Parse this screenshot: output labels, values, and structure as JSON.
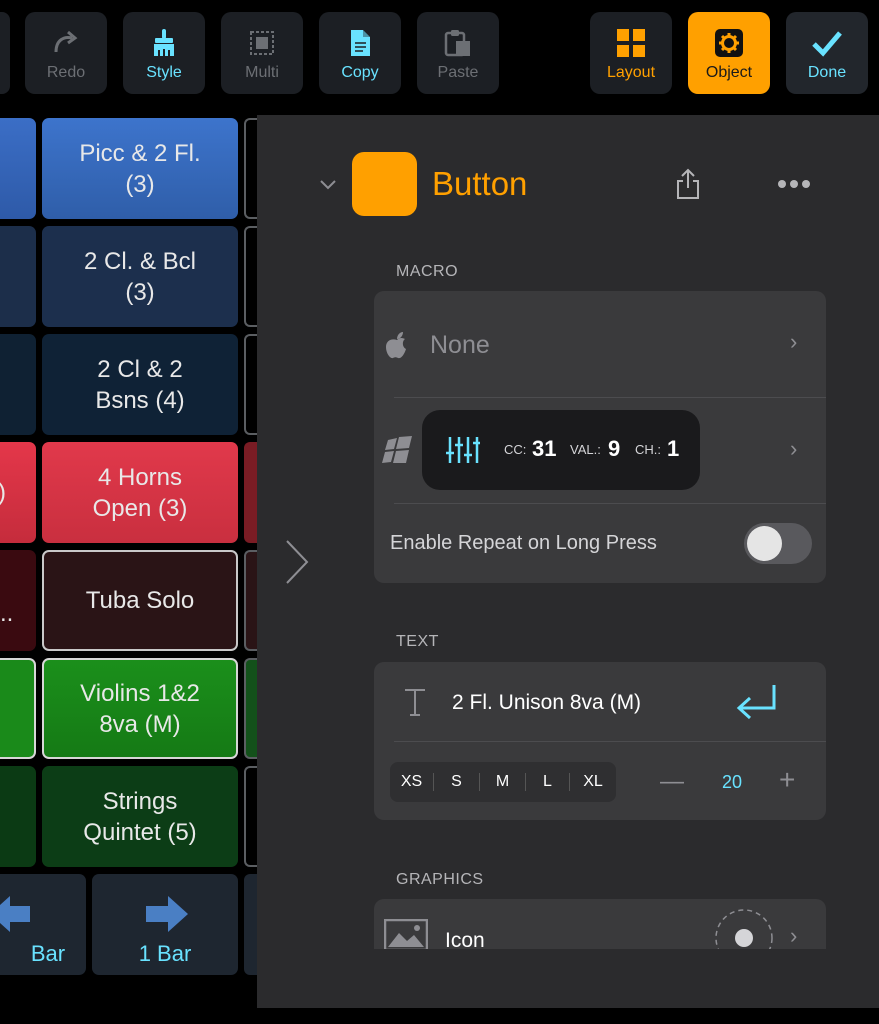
{
  "toolbar": {
    "redo": "Redo",
    "style": "Style",
    "multi": "Multi",
    "copy": "Copy",
    "paste": "Paste",
    "layout": "Layout",
    "object": "Object",
    "done": "Done"
  },
  "grid": {
    "cells": [
      {
        "line1": "Picc & 2 Fl.",
        "line2": "(3)"
      },
      {
        "line1": "2 Cl. & Bcl",
        "line2": "(3)"
      },
      {
        "line1": "2 Cl & 2",
        "line2": "Bsns (4)"
      },
      {
        "line1": "4 Horns",
        "line2": "Open (3)"
      },
      {
        "line1": "Tuba Solo",
        "line2": ""
      },
      {
        "line1": "Violins 1&2",
        "line2": "8va (M)"
      },
      {
        "line1": "Strings",
        "line2": "Quintet (5)"
      }
    ],
    "left_partial_red": ")",
    "left_partial_dark": "..",
    "bar_left": "Bar",
    "bar_right": "1 Bar"
  },
  "panel": {
    "object_name": "Button",
    "macro_title": "MACRO",
    "macro_mac_value": "None",
    "macro_cc_label": "CC:",
    "macro_cc_value": "31",
    "macro_val_label": "VAL.:",
    "macro_val_value": "9",
    "macro_ch_label": "CH.:",
    "macro_ch_value": "1",
    "repeat_label": "Enable Repeat on Long Press",
    "repeat_on": false,
    "text_title": "TEXT",
    "text_value": "2 Fl. Unison 8va (M)",
    "sizes": [
      "XS",
      "S",
      "M",
      "L",
      "XL"
    ],
    "font_size": "20",
    "graphics_title": "GRAPHICS",
    "icon_label": "Icon"
  },
  "colors": {
    "accent_orange": "#ffa000",
    "accent_cyan": "#69e2ff"
  }
}
